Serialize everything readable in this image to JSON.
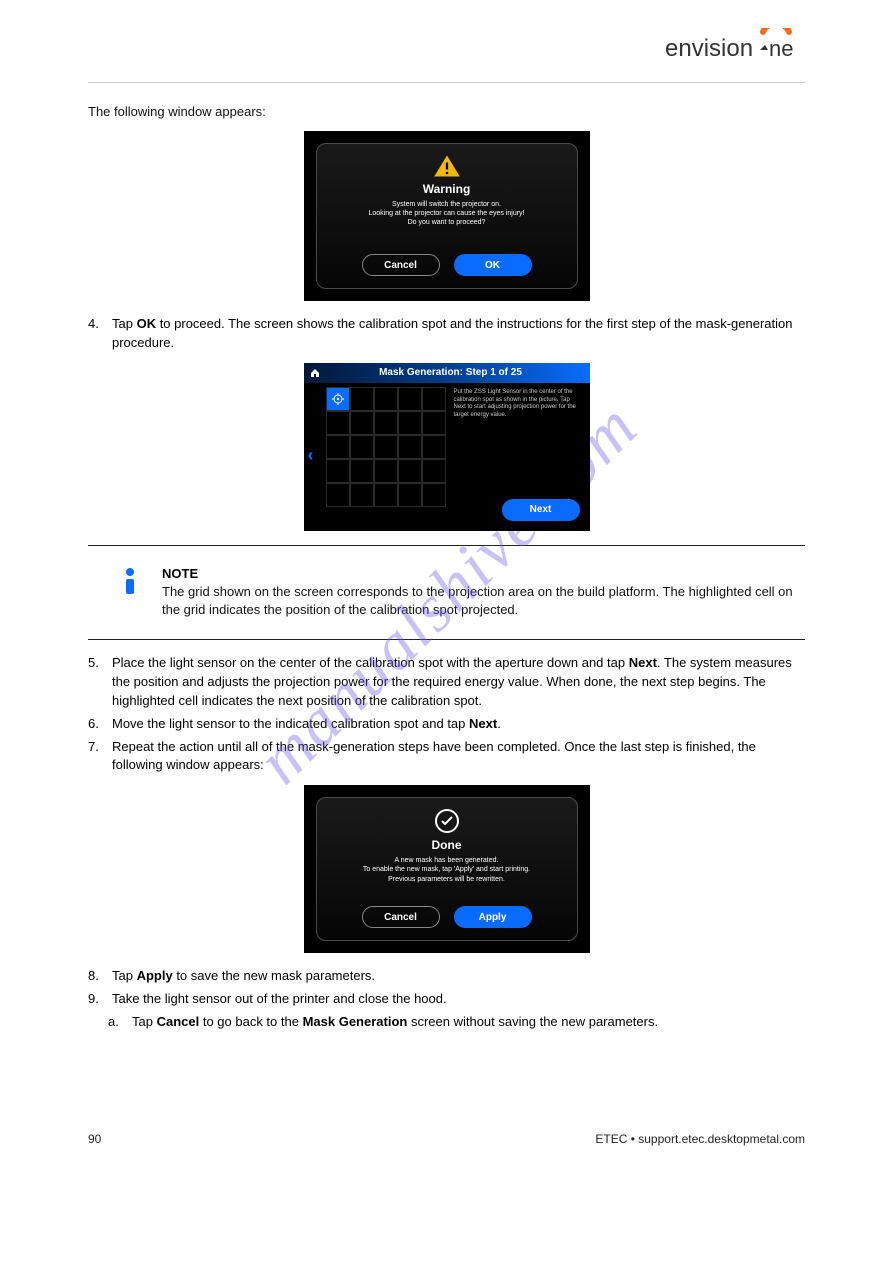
{
  "watermark": "manualshive.com",
  "intro_text": "The following window appears:",
  "warning_dialog": {
    "title": "Warning",
    "line1": "System will switch the projector on.",
    "line2": "Looking at the projector can cause the eyes injury!",
    "line3": "Do you want to proceed?",
    "cancel": "Cancel",
    "ok": "OK"
  },
  "step4_num": "4.",
  "step4_text_a": "Tap ",
  "step4_bold": "OK",
  "step4_text_b": " to proceed. The screen shows the calibration spot and the instructions for the first step of the mask-generation procedure.",
  "mask_screen": {
    "title": "Mask Generation: Step 1 of 25",
    "side_text": "Put the ZSS Light Sensor in the center of the calibration spot as shown in the picture. Tap Next to start adjusting projection power for the target energy value.",
    "next": "Next"
  },
  "info": {
    "heading": "NOTE",
    "body": "The grid shown on the screen corresponds to the projection area on the build platform. The highlighted cell on the grid indicates the position of the calibration spot projected."
  },
  "step5_num": "5.",
  "step5_a": "Place the light sensor on the center of the calibration spot with the aperture down and tap ",
  "step5_b1": "Next",
  "step5_c": ". The system measures the position and adjusts the projection power for the required energy value. When done, the next step begins. The highlighted cell indicates the next position of the calibration spot.",
  "step6_num": "6.",
  "step6_a": "Move the light sensor to the indicated calibration spot and tap ",
  "step6_b": "Next",
  "step6_c": ".",
  "step7_num": "7.",
  "step7_a": "Repeat the action until all of the mask-generation steps have been completed. Once the last step is finished, the following window appears:",
  "done_dialog": {
    "title": "Done",
    "line1": "A new mask has been generated.",
    "line2": "To enable the new mask, tap 'Apply' and start printing.",
    "line3": "Previous parameters will be rewritten.",
    "cancel": "Cancel",
    "apply": "Apply"
  },
  "step8_num": "8.",
  "step8_a": "Tap ",
  "step8_b": "Apply",
  "step8_c": " to save the new mask parameters.",
  "step9_num": "9.",
  "step9_a": "Take the light sensor out of the printer and close the hood.",
  "stepA_num": "a.",
  "stepA_a": "Tap ",
  "stepA_b": "Cancel",
  "stepA_c": " to go back to the ",
  "stepA_d": "Mask Generation",
  "stepA_e": " screen without saving the new parameters.",
  "footer_left": "90",
  "footer_right": "ETEC  •  support.etec.desktopmetal.com"
}
